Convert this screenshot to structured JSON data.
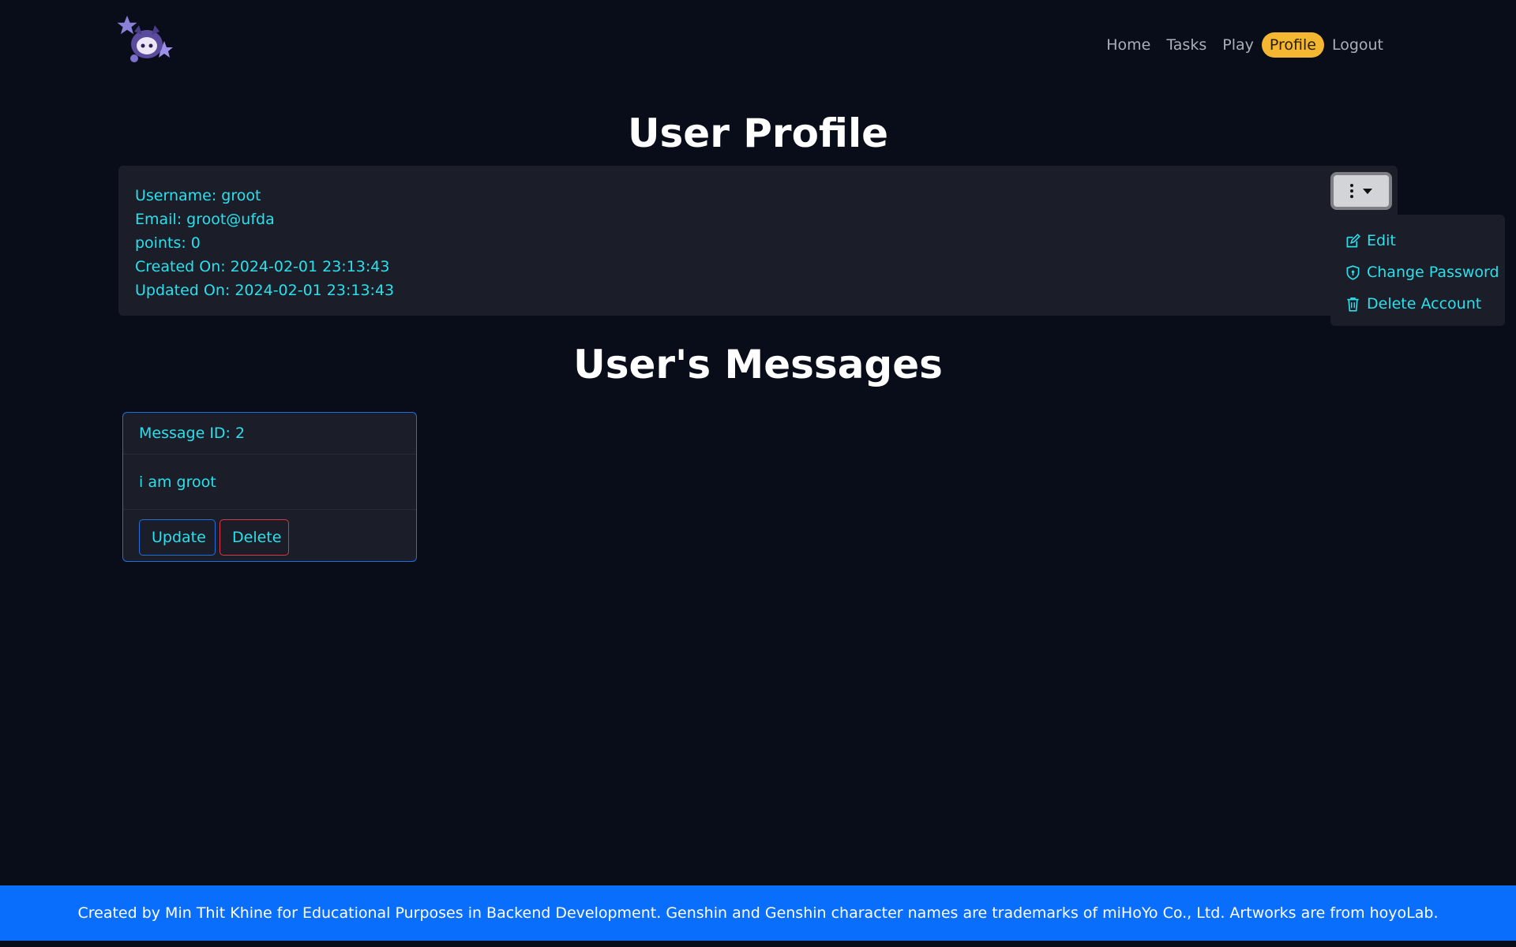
{
  "logo": {
    "name": "chibi-mascot-logo"
  },
  "nav": {
    "items": [
      {
        "label": "Home"
      },
      {
        "label": "Tasks"
      },
      {
        "label": "Play"
      },
      {
        "label": "Profile",
        "active": true
      },
      {
        "label": "Logout"
      }
    ],
    "active_color": "#f5b731"
  },
  "profile": {
    "title": "User Profile",
    "username_line": "Username: groot",
    "email_line": "Email: groot@ufda",
    "points_line": "points: 0",
    "created_line": "Created On: 2024-02-01 23:13:43",
    "updated_line": "Updated On: 2024-02-01 23:13:43",
    "menu_button_icon": "kebab-menu-icon",
    "menu": {
      "open": true,
      "items": [
        {
          "label": "Edit",
          "icon": "edit-icon"
        },
        {
          "label": "Change Password",
          "icon": "shield-icon"
        },
        {
          "label": "Delete Account",
          "icon": "trash-icon"
        }
      ]
    }
  },
  "messages": {
    "title": "User's Messages",
    "items": [
      {
        "header": "Message ID: 2",
        "text": "i am groot",
        "update_label": "Update",
        "delete_label": "Delete"
      }
    ]
  },
  "footer": {
    "text": "Created by Min Thit Khine for Educational Purposes in Backend Development. Genshin and Genshin character names are trademarks of miHoYo Co., Ltd. Artworks are from hoyoLab."
  },
  "colors": {
    "background": "#090d1a",
    "card": "#1b1e28",
    "text_accent": "#29e0ec",
    "primary": "#0a6efd",
    "danger": "#dc3545"
  }
}
